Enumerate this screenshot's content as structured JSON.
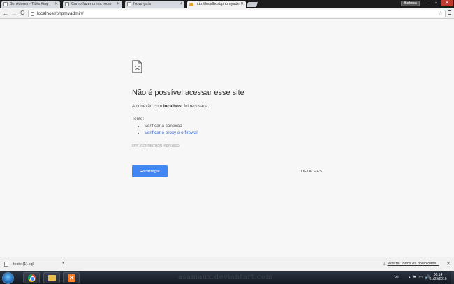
{
  "tabs": [
    {
      "title": "Servidores - Tibia King",
      "active": false
    },
    {
      "title": "Como fazer um ot rodar",
      "active": false
    },
    {
      "title": "Nova guia",
      "active": false
    },
    {
      "title": "http://localhost/phpmyadm",
      "active": true
    }
  ],
  "user_button": "Barbosa",
  "toolbar": {
    "url": "localhost/phpmyadmin/",
    "back": "←",
    "forward": "→",
    "reload": "C"
  },
  "error": {
    "title": "Não é possível acessar esse site",
    "message_prefix": "A conexão com ",
    "host": "localhost",
    "message_suffix": " foi recusada.",
    "try_label": "Tente:",
    "suggestions": [
      "Verificar a conexão",
      "Verificar o proxy e o firewall"
    ],
    "code": "ERR_CONNECTION_REFUSED",
    "reload_label": "Recarregar",
    "details_label": "DETALHES"
  },
  "download_shelf": {
    "file_name": "teste (1).sql",
    "show_all": "Mostrar todos os downloads..."
  },
  "taskbar": {
    "watermark": "asamaux.deviantart.com",
    "language": "PT",
    "time": "00:14",
    "date": "01/09/2016"
  },
  "colors": {
    "accent_button": "#4285f4",
    "link": "#3367d6",
    "page_background": "#f7f7f7"
  }
}
